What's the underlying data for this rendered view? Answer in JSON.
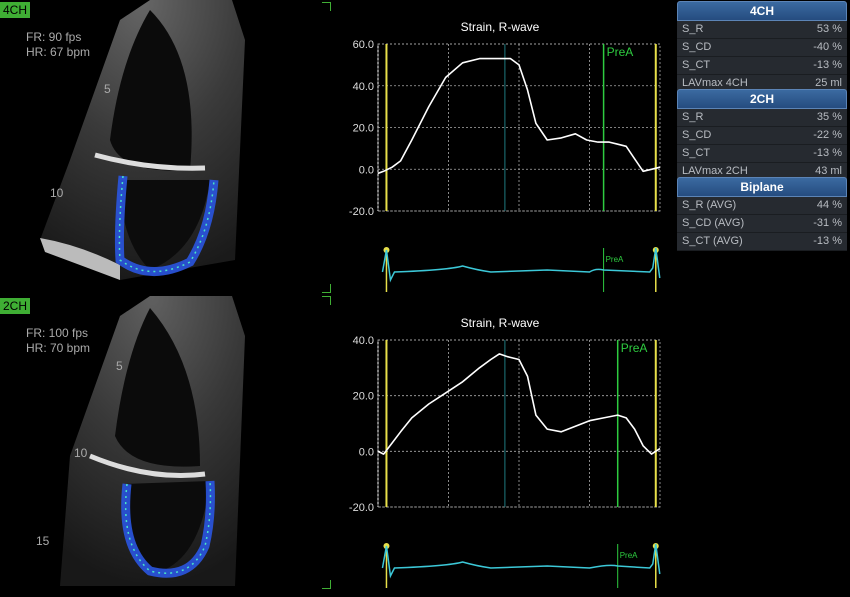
{
  "views": [
    {
      "tag": "4CH",
      "fr": "FR: 90 fps",
      "hr": "HR: 67 bpm",
      "depth_marks": [
        "5",
        "10"
      ]
    },
    {
      "tag": "2CH",
      "fr": "FR: 100 fps",
      "hr": "HR: 70 bpm",
      "depth_marks": [
        "5",
        "10",
        "15"
      ]
    }
  ],
  "colors": {
    "tag_green": "#3fae34",
    "marker_yellow": "#e8e04a",
    "marker_green": "#2ecc40",
    "ecg_cyan": "#3cc8d8",
    "panel_blue": "#2f5d92"
  },
  "charts": [
    {
      "title": "Strain, R-wave",
      "marker_label": "PreA",
      "chart_data": {
        "type": "line",
        "title": "Strain, R-wave",
        "yticks": [
          "60.0",
          "40.0",
          "20.0",
          "0.0",
          "-20.0"
        ],
        "ylim": [
          -20,
          60
        ],
        "x": [
          0,
          0.02,
          0.05,
          0.08,
          0.12,
          0.18,
          0.24,
          0.3,
          0.36,
          0.42,
          0.47,
          0.5,
          0.53,
          0.56,
          0.6,
          0.65,
          0.7,
          0.74,
          0.78,
          0.82,
          0.85,
          0.88,
          0.91,
          0.94,
          0.97,
          1.0
        ],
        "values": [
          -2,
          -1,
          1,
          4,
          14,
          30,
          44,
          51,
          53,
          53,
          53,
          50,
          38,
          22,
          14,
          15,
          17,
          14,
          13,
          13,
          12,
          11,
          5,
          -1,
          0,
          1
        ],
        "markers": {
          "yellow": [
            0.03,
            0.985
          ],
          "green": [
            0.8
          ],
          "teal": [
            0.45
          ]
        }
      }
    },
    {
      "title": "Strain, R-wave",
      "marker_label": "PreA",
      "chart_data": {
        "type": "line",
        "title": "Strain, R-wave",
        "yticks": [
          "40.0",
          "20.0",
          "0.0",
          "-20.0"
        ],
        "ylim": [
          -20,
          40
        ],
        "x": [
          0,
          0.02,
          0.05,
          0.08,
          0.12,
          0.18,
          0.24,
          0.3,
          0.36,
          0.4,
          0.43,
          0.46,
          0.5,
          0.53,
          0.56,
          0.6,
          0.65,
          0.7,
          0.75,
          0.8,
          0.85,
          0.88,
          0.91,
          0.94,
          0.97,
          1.0
        ],
        "values": [
          0,
          -1,
          3,
          7,
          12,
          17,
          21,
          25,
          30,
          33,
          35,
          34,
          33,
          27,
          13,
          8,
          7,
          9,
          11,
          12,
          13,
          12,
          8,
          2,
          -1,
          1
        ],
        "markers": {
          "yellow": [
            0.03,
            0.985
          ],
          "green": [
            0.85
          ],
          "teal": [
            0.45
          ]
        }
      }
    }
  ],
  "ecg_marker_label": "PreA",
  "panels": [
    {
      "title": "4CH",
      "rows": [
        {
          "label": "S_R",
          "value": "53 %"
        },
        {
          "label": "S_CD",
          "value": "-40 %"
        },
        {
          "label": "S_CT",
          "value": "-13 %"
        },
        {
          "label": "LAVmax 4CH",
          "value": "25 ml"
        }
      ]
    },
    {
      "title": "2CH",
      "rows": [
        {
          "label": "S_R",
          "value": "35 %"
        },
        {
          "label": "S_CD",
          "value": "-22 %"
        },
        {
          "label": "S_CT",
          "value": "-13 %"
        },
        {
          "label": "LAVmax 2CH",
          "value": "43 ml"
        }
      ]
    },
    {
      "title": "Biplane",
      "rows": [
        {
          "label": "S_R (AVG)",
          "value": "44 %"
        },
        {
          "label": "S_CD (AVG)",
          "value": "-31 %"
        },
        {
          "label": "S_CT (AVG)",
          "value": "-13 %"
        }
      ]
    }
  ]
}
